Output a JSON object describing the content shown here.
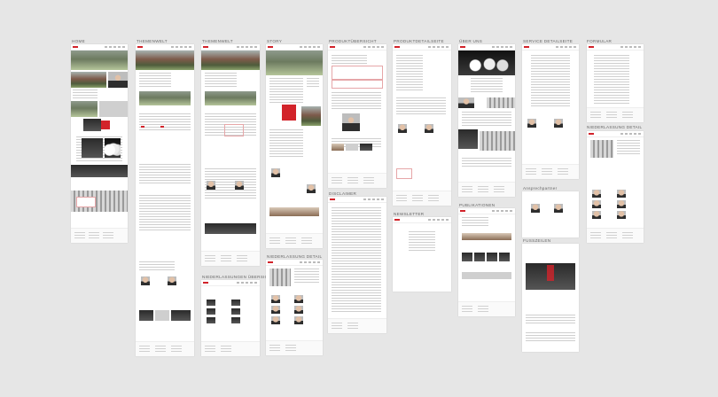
{
  "boards": [
    {
      "id": "home",
      "label": "HOME"
    },
    {
      "id": "themenwelt-1",
      "label": "THEMENWELT"
    },
    {
      "id": "themenwelt-2",
      "label": "THEMENWELT"
    },
    {
      "id": "story",
      "label": "STORY"
    },
    {
      "id": "produktuebersicht",
      "label": "PRODUKTÜBERSICHT"
    },
    {
      "id": "produktdetailseite",
      "label": "PRODUKTDETAILSEITE"
    },
    {
      "id": "ueber-uns",
      "label": "ÜBER UNS"
    },
    {
      "id": "service-detailseite",
      "label": "SERVICE DETAILSEITE"
    },
    {
      "id": "formular",
      "label": "FORMULAR"
    },
    {
      "id": "niederlassung-detail",
      "label": "NIEDERLASSUNG DETAIL"
    },
    {
      "id": "disclaimer",
      "label": "DISCLAIMER"
    },
    {
      "id": "newsletter",
      "label": "NEWSLETTER"
    },
    {
      "id": "publikationen",
      "label": "PUBLIKATIONEN"
    },
    {
      "id": "ansprechpartner",
      "label": "Ansprechpartner"
    },
    {
      "id": "fusszeilen",
      "label": "FUSSZEILEN"
    },
    {
      "id": "niederlassung-detail-2",
      "label": "NIEDERLASSUNG DETAIL"
    },
    {
      "id": "niederlassungen-uebersicht",
      "label": "NIEDERLASSUNGEN ÜBERSICHT"
    }
  ],
  "colors": {
    "canvas": "#e6e6e6",
    "board": "#ffffff",
    "accent": "#d2232a"
  }
}
